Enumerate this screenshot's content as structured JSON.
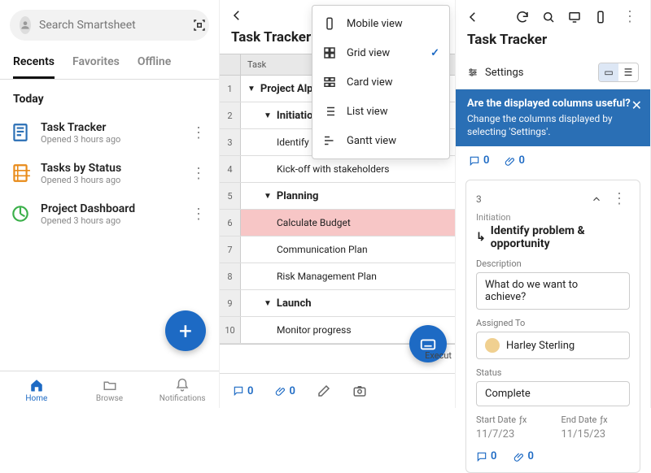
{
  "pane1": {
    "search_placeholder": "Search Smartsheet",
    "tabs": [
      "Recents",
      "Favorites",
      "Offline"
    ],
    "active_tab": 0,
    "section": "Today",
    "files": [
      {
        "name": "Task Tracker",
        "sub": "Opened 3 hours ago",
        "color": "#2a6fb5"
      },
      {
        "name": "Tasks by Status",
        "sub": "Opened 3 hours ago",
        "color": "#e88b1a"
      },
      {
        "name": "Project Dashboard",
        "sub": "Opened 3 hours ago",
        "color": "#3bb04a"
      }
    ],
    "bottom_nav": [
      "Home",
      "Browse",
      "Notifications"
    ]
  },
  "pane2": {
    "title": "Task Tracker",
    "column_header": "Task",
    "rows": [
      {
        "n": 1,
        "text": "Project Alpha",
        "level": 0,
        "caret": true
      },
      {
        "n": 2,
        "text": "Initiation",
        "level": 1,
        "caret": true
      },
      {
        "n": 3,
        "text": "Identify problem & opportunity",
        "level": 2
      },
      {
        "n": 4,
        "text": "Kick-off with stakeholders",
        "level": 2
      },
      {
        "n": 5,
        "text": "Planning",
        "level": 1,
        "caret": true
      },
      {
        "n": 6,
        "text": "Calculate Budget",
        "level": 2,
        "highlight": true
      },
      {
        "n": 7,
        "text": "Communication Plan",
        "level": 2
      },
      {
        "n": 8,
        "text": "Risk Management Plan",
        "level": 2
      },
      {
        "n": 9,
        "text": "Launch",
        "level": 1,
        "caret": true
      },
      {
        "n": 10,
        "text": "Monitor progress",
        "level": 2
      }
    ],
    "edge_text": "Execut",
    "view_menu": [
      {
        "label": "Mobile view",
        "icon": "mobile"
      },
      {
        "label": "Grid view",
        "icon": "grid",
        "checked": true
      },
      {
        "label": "Card view",
        "icon": "card"
      },
      {
        "label": "List view",
        "icon": "list"
      },
      {
        "label": "Gantt view",
        "icon": "gantt"
      }
    ],
    "comments_count": "0",
    "attachments_count": "0"
  },
  "pane3": {
    "title": "Task Tracker",
    "settings_label": "Settings",
    "banner_title": "Are the displayed columns useful?",
    "banner_text": "Change the columns displayed by selecting 'Settings'.",
    "strip_comments": "0",
    "strip_attachments": "0",
    "card": {
      "row_num": "3",
      "parent": "Initiation",
      "title": "Identify problem & opportunity",
      "desc_label": "Description",
      "desc_value": "What do we want to achieve?",
      "assigned_label": "Assigned To",
      "assigned_value": "Harley Sterling",
      "status_label": "Status",
      "status_value": "Complete",
      "start_label": "Start Date",
      "start_value": "11/7/23",
      "end_label": "End Date",
      "end_value": "11/15/23",
      "comments": "0",
      "attachments": "0"
    }
  }
}
